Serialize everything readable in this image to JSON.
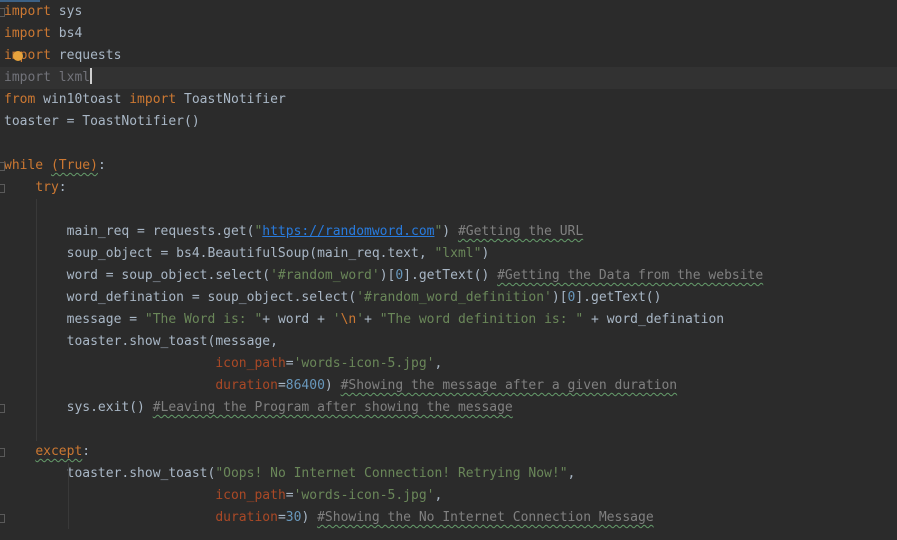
{
  "editor": {
    "language": "python",
    "colors": {
      "background": "#2b2b2b",
      "keyword": "#cc7832",
      "string": "#6a8759",
      "number": "#6897bb",
      "comment": "#808080",
      "parameter": "#aa4926",
      "default": "#a9b7c6"
    },
    "lines": [
      [
        {
          "t": "import",
          "c": "kw"
        },
        {
          "t": " sys"
        }
      ],
      [
        {
          "t": "import",
          "c": "kw"
        },
        {
          "t": " bs4"
        }
      ],
      [
        {
          "t": "import",
          "c": "kw"
        },
        {
          "t": " requests"
        }
      ],
      [
        {
          "t": "import",
          "c": "kw unused"
        },
        {
          "t": " lxml",
          "c": "unused"
        }
      ],
      [
        {
          "t": "from",
          "c": "kw"
        },
        {
          "t": " win10toast "
        },
        {
          "t": "import",
          "c": "kw"
        },
        {
          "t": " ToastNotifier"
        }
      ],
      [
        {
          "t": "toaster = ToastNotifier()"
        }
      ],
      [],
      [
        {
          "t": "while",
          "c": "kw"
        },
        {
          "t": " "
        },
        {
          "t": "(True)",
          "c": "typo-kw"
        },
        {
          "t": ":"
        }
      ],
      [
        {
          "t": "    "
        },
        {
          "t": "try",
          "c": "kw"
        },
        {
          "t": ":"
        }
      ],
      [],
      [
        {
          "t": "        main_req = requests.get("
        },
        {
          "t": "\"",
          "c": "str"
        },
        {
          "t": "https://randomword.com",
          "c": "link"
        },
        {
          "t": "\"",
          "c": "str"
        },
        {
          "t": ") "
        },
        {
          "t": "#Getting the URL",
          "c": "cmt typo"
        }
      ],
      [
        {
          "t": "        soup_object = bs4.BeautifulSoup(main_req.text, "
        },
        {
          "t": "\"lxml\"",
          "c": "str"
        },
        {
          "t": ")"
        }
      ],
      [
        {
          "t": "        word = soup_object.select("
        },
        {
          "t": "'#random_word'",
          "c": "str"
        },
        {
          "t": ")["
        },
        {
          "t": "0",
          "c": "num"
        },
        {
          "t": "].getText() "
        },
        {
          "t": "#Getting the Data from the website",
          "c": "cmt typo"
        }
      ],
      [
        {
          "t": "        word_defination = soup_object.select("
        },
        {
          "t": "'#random_word_definition'",
          "c": "str"
        },
        {
          "t": ")["
        },
        {
          "t": "0",
          "c": "num"
        },
        {
          "t": "].getText()"
        }
      ],
      [
        {
          "t": "        message = "
        },
        {
          "t": "\"The Word is: \"",
          "c": "str"
        },
        {
          "t": "+ word + "
        },
        {
          "t": "'",
          "c": "str"
        },
        {
          "t": "\\n",
          "c": "kw"
        },
        {
          "t": "'",
          "c": "str"
        },
        {
          "t": "+ "
        },
        {
          "t": "\"The word definition is: \"",
          "c": "str"
        },
        {
          "t": " + word_defination"
        }
      ],
      [
        {
          "t": "        toaster.show_toast(message,"
        }
      ],
      [
        {
          "t": "                           "
        },
        {
          "t": "icon_path",
          "c": "param"
        },
        {
          "t": "="
        },
        {
          "t": "'words-icon-5.jpg'",
          "c": "str"
        },
        {
          "t": ","
        }
      ],
      [
        {
          "t": "                           "
        },
        {
          "t": "duration",
          "c": "param"
        },
        {
          "t": "="
        },
        {
          "t": "86400",
          "c": "num"
        },
        {
          "t": ") "
        },
        {
          "t": "#Showing the message after a given duration",
          "c": "cmt typo"
        }
      ],
      [
        {
          "t": "        sys.exit() "
        },
        {
          "t": "#Leaving the Program after showing the message",
          "c": "cmt typo"
        }
      ],
      [],
      [
        {
          "t": "    "
        },
        {
          "t": "except",
          "c": "kw typo"
        },
        {
          "t": ":"
        }
      ],
      [
        {
          "t": "        toaster.show_toast("
        },
        {
          "t": "\"Oops! No Internet Connection! Retrying Now!\"",
          "c": "str"
        },
        {
          "t": ","
        }
      ],
      [
        {
          "t": "                           "
        },
        {
          "t": "icon_path",
          "c": "param"
        },
        {
          "t": "="
        },
        {
          "t": "'words-icon-5.jpg'",
          "c": "str"
        },
        {
          "t": ","
        }
      ],
      [
        {
          "t": "                           "
        },
        {
          "t": "duration",
          "c": "param"
        },
        {
          "t": "="
        },
        {
          "t": "30",
          "c": "num"
        },
        {
          "t": ") "
        },
        {
          "t": "#Showing the No Internet Connection Message",
          "c": "cmt typo"
        }
      ]
    ],
    "current_line_index": 3,
    "fold_marker_line_indices": [
      0,
      7,
      8,
      18,
      20,
      23
    ],
    "intention_bulb_line_index": 2,
    "icons": {
      "intention_bulb": "lightbulb-icon",
      "fold_marker": "fold-marker-icon",
      "caret": "text-caret"
    }
  }
}
